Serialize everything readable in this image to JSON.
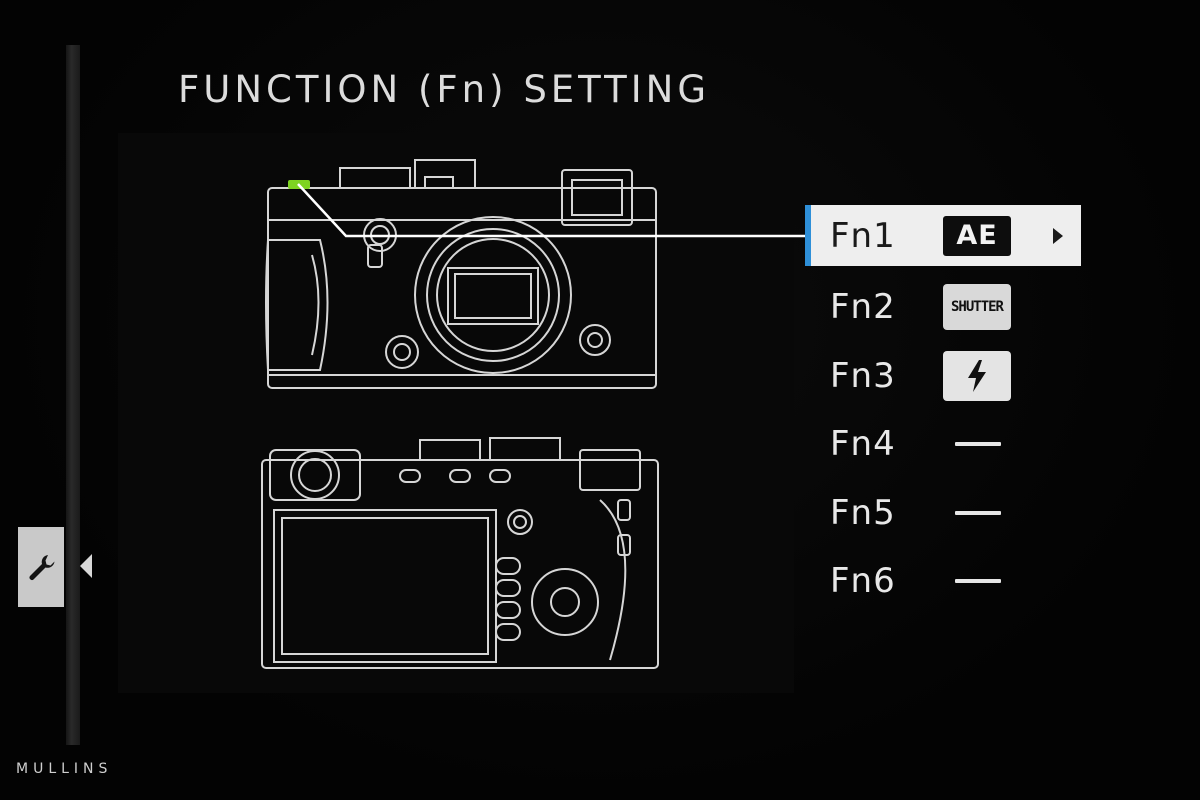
{
  "title": "FUNCTION (Fn) SETTING",
  "side_tab": {
    "icon": "wrench-icon"
  },
  "function_buttons": [
    {
      "label": "Fn1",
      "assignment_text": "AE",
      "icon": "ae-badge-icon",
      "selected": true
    },
    {
      "label": "Fn2",
      "assignment_text": "SHUTTER",
      "icon": "shutter-badge-icon",
      "selected": false
    },
    {
      "label": "Fn3",
      "assignment_text": "",
      "icon": "flash-icon",
      "selected": false
    },
    {
      "label": "Fn4",
      "assignment_text": "",
      "icon": "none-dash-icon",
      "selected": false
    },
    {
      "label": "Fn5",
      "assignment_text": "",
      "icon": "none-dash-icon",
      "selected": false
    },
    {
      "label": "Fn6",
      "assignment_text": "",
      "icon": "none-dash-icon",
      "selected": false
    }
  ],
  "colors": {
    "selection_accent": "#2e8fd8",
    "selected_row_bg": "#eeeeee",
    "button_highlight": "#7ed321",
    "background": "#040404"
  },
  "watermark": "MULLINS"
}
